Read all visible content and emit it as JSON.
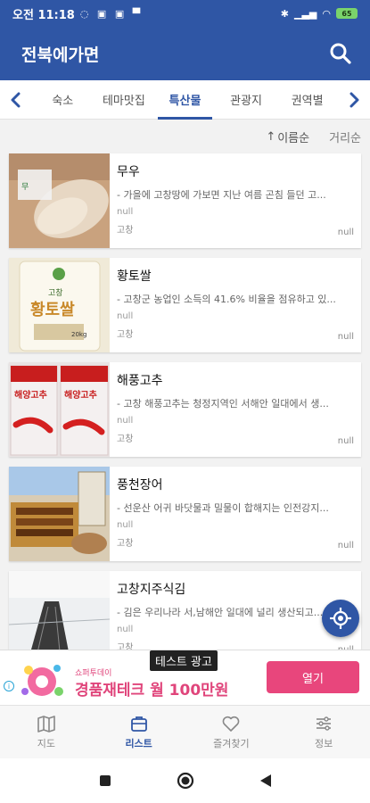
{
  "status_bar": {
    "time": "오전 11:18",
    "battery": "65"
  },
  "app": {
    "title": "전북에가면"
  },
  "tabs": [
    {
      "label": "숙소",
      "active": false
    },
    {
      "label": "테마맛집",
      "active": false
    },
    {
      "label": "특산물",
      "active": true
    },
    {
      "label": "관광지",
      "active": false
    },
    {
      "label": "권역별",
      "active": false
    }
  ],
  "sort": {
    "name_label": "이름순",
    "distance_label": "거리순"
  },
  "items": [
    {
      "name": "무우",
      "desc": "- 가을에 고창땅에 가보면 지난 여름 곤침 들던 고...",
      "meta": "null",
      "region": "고창",
      "right": "null"
    },
    {
      "name": "황토쌀",
      "desc": "- 고창군 농업인 소득의 41.6% 비율을 점유하고 있...",
      "meta": "null",
      "region": "고창",
      "right": "null"
    },
    {
      "name": "해풍고추",
      "desc": "- 고창 해풍고추는 청정지역인 서해안 일대에서 생...",
      "meta": "null",
      "region": "고창",
      "right": "null"
    },
    {
      "name": "풍천장어",
      "desc": "- 선운산 어귀 바닷물과 밀물이 합해지는 인전강지...",
      "meta": "null",
      "region": "고창",
      "right": "null"
    },
    {
      "name": "고창지주식김",
      "desc": "- 김은 우리나라 서,남해안 일대에 널리 생산되고...",
      "meta": "null",
      "region": "고창",
      "right": "null"
    }
  ],
  "thumb_text": {
    "rice_brand": "고창",
    "rice_label": "황토쌀",
    "rice_weight": "20kg",
    "pepper_label": "해양고추"
  },
  "ad": {
    "tag": "테스트 광고",
    "sponsor": "쇼퍼투데이",
    "headline": "경품재테크 월 100만원",
    "cta": "열기",
    "info_icon": "i"
  },
  "bottom_nav": [
    {
      "label": "지도",
      "icon": "map-icon",
      "active": false
    },
    {
      "label": "리스트",
      "icon": "bag-icon",
      "active": true
    },
    {
      "label": "즐겨찾기",
      "icon": "heart-icon",
      "active": false
    },
    {
      "label": "정보",
      "icon": "settings-icon",
      "active": false
    }
  ],
  "colors": {
    "primary": "#2f56a5",
    "ad_pink": "#e8467c"
  }
}
